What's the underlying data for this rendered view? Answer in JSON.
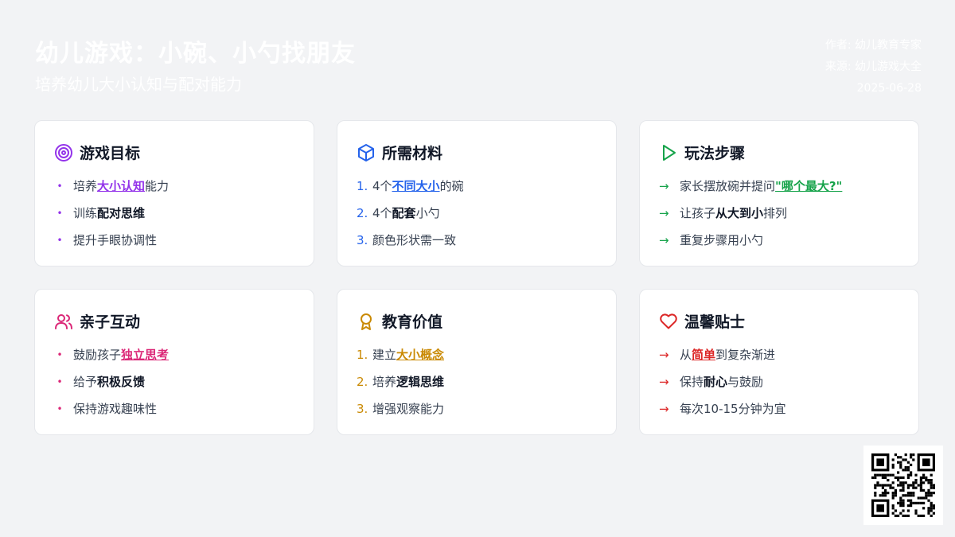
{
  "header": {
    "title": "幼儿游戏：小碗、小勺找朋友",
    "subtitle": "培养幼儿大小认知与配对能力",
    "author": "作者: 幼儿教育专家",
    "source": "来源: 幼儿游戏大全",
    "date": "2025-06-28"
  },
  "colors": {
    "goals": "#9333ea",
    "materials": "#2563eb",
    "steps": "#16a34a",
    "interaction": "#db2777",
    "value": "#ca8a04",
    "tips": "#dc2626"
  },
  "cards": {
    "goals": {
      "icon": "target-icon",
      "title": "游戏目标",
      "items": [
        {
          "pre": "培养",
          "em": "大小认知",
          "post": "能力"
        },
        {
          "pre": "训练",
          "em": "配对思维",
          "post": ""
        },
        {
          "pre": "提升手眼协调性",
          "em": "",
          "post": ""
        }
      ]
    },
    "materials": {
      "icon": "cube-icon",
      "title": "所需材料",
      "items": [
        {
          "num": "1.",
          "pre": "4个",
          "em": "不同大小",
          "post": "的碗"
        },
        {
          "num": "2.",
          "pre": "4个",
          "em": "配套",
          "post": "小勺"
        },
        {
          "num": "3.",
          "pre": "颜色形状需一致",
          "em": "",
          "post": ""
        }
      ]
    },
    "steps": {
      "icon": "play-icon",
      "title": "玩法步骤",
      "items": [
        {
          "pre": "家长摆放碗并提问",
          "em": "\"哪个最大?\"",
          "post": ""
        },
        {
          "pre": "让孩子",
          "em": "从大到小",
          "post": "排列"
        },
        {
          "pre": "重复步骤用小勺",
          "em": "",
          "post": ""
        }
      ]
    },
    "interaction": {
      "icon": "users-icon",
      "title": "亲子互动",
      "items": [
        {
          "pre": "鼓励孩子",
          "em": "独立思考",
          "post": ""
        },
        {
          "pre": "给予",
          "em": "积极反馈",
          "post": ""
        },
        {
          "pre": "保持游戏趣味性",
          "em": "",
          "post": ""
        }
      ]
    },
    "value": {
      "icon": "award-icon",
      "title": "教育价值",
      "items": [
        {
          "num": "1.",
          "pre": "建立",
          "em": "大小概念",
          "post": ""
        },
        {
          "num": "2.",
          "pre": "培养",
          "em": "逻辑思维",
          "post": ""
        },
        {
          "num": "3.",
          "pre": "增强观察能力",
          "em": "",
          "post": ""
        }
      ]
    },
    "tips": {
      "icon": "heart-icon",
      "title": "温馨贴士",
      "items": [
        {
          "pre": "从",
          "em": "简单",
          "post": "到复杂渐进"
        },
        {
          "pre": "保持",
          "em": "耐心",
          "post": "与鼓励"
        },
        {
          "pre": "每次10-15分钟为宜",
          "em": "",
          "post": ""
        }
      ]
    }
  },
  "qr": {
    "icon": "qr-code-icon"
  }
}
